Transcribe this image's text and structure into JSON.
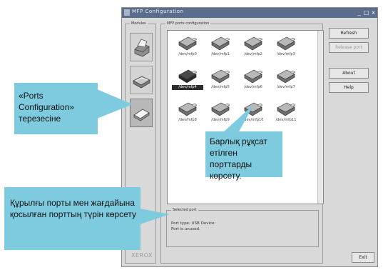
{
  "window": {
    "title": "MFP Configuration",
    "controls": [
      "_",
      "□",
      "x"
    ]
  },
  "modules": {
    "legend": "Modules",
    "items": [
      {
        "icon": "printer-icon"
      },
      {
        "icon": "scanner-icon"
      },
      {
        "icon": "ports-configuration-icon",
        "active": true
      }
    ]
  },
  "ports_group": {
    "legend": "MFP ports configuration",
    "ports": [
      {
        "label": "/dev/mfp0",
        "selected": false
      },
      {
        "label": "/dev/mfp1",
        "selected": false
      },
      {
        "label": "/dev/mfp2",
        "selected": false
      },
      {
        "label": "/dev/mfp3",
        "selected": false
      },
      {
        "label": "/dev/mfp4",
        "selected": true
      },
      {
        "label": "/dev/mfp5",
        "selected": false
      },
      {
        "label": "/dev/mfp6",
        "selected": false
      },
      {
        "label": "/dev/mfp7",
        "selected": false
      },
      {
        "label": "/dev/mfp8",
        "selected": false
      },
      {
        "label": "/dev/mfp9",
        "selected": false
      },
      {
        "label": "/dev/mfp10",
        "selected": false
      },
      {
        "label": "/dev/mfp11",
        "selected": false
      }
    ]
  },
  "selected_port": {
    "legend": "Selected port",
    "type_line": "Port type: USB   Device:",
    "status_line": "Port is unused."
  },
  "buttons": {
    "refresh": "Refresh",
    "release_port": "Release port",
    "about": "About",
    "help": "Help",
    "exit": "Exit"
  },
  "brand": "XEROX",
  "callouts": {
    "ports_config": "«Ports Configuration» терезесіне",
    "all_ports": "Барлық рұқсат етілген порттарды көрсету.",
    "port_type": "Құрылғы порты мен жағдайына қосылған порттың түрін көрсету"
  },
  "colors": {
    "callout": "#7ecbe0",
    "titlebar": "#5b6d8c",
    "window_bg": "#d9d9d9"
  }
}
